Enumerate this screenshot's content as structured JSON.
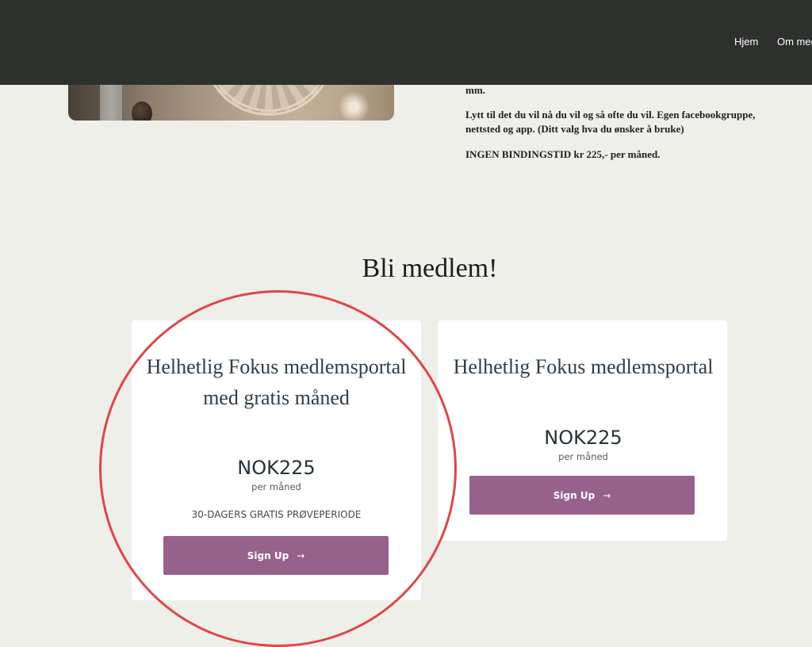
{
  "nav": {
    "items": [
      "Hjem",
      "Om meg"
    ]
  },
  "intro": {
    "line_cut": "mm.",
    "paragraph_listen": "Lytt til det du vil nå du vil og så ofte du vil. Egen facebookgruppe, nettsted og app. (Ditt valg hva du ønsker å bruke)",
    "paragraph_price": "INGEN BINDINGSTID kr 225,- per måned."
  },
  "membership": {
    "title": "Bli medlem!",
    "plans": [
      {
        "title": "Helhetlig Fokus medlemsportal med gratis måned",
        "price": "NOK225",
        "period": "per måned",
        "trial": "30-DAGERS GRATIS PRØVEPERIODE",
        "button_label": "Sign Up",
        "button_icon": "arrow-right-icon"
      },
      {
        "title": "Helhetlig Fokus medlemsportal",
        "price": "NOK225",
        "period": "per måned",
        "button_label": "Sign Up",
        "button_icon": "arrow-right-icon"
      }
    ]
  },
  "colors": {
    "header_bg": "#2d302d",
    "page_bg": "#efefea",
    "button": "#96628c",
    "highlight_circle": "#e0454a",
    "plan_title": "#2e3e4a"
  }
}
